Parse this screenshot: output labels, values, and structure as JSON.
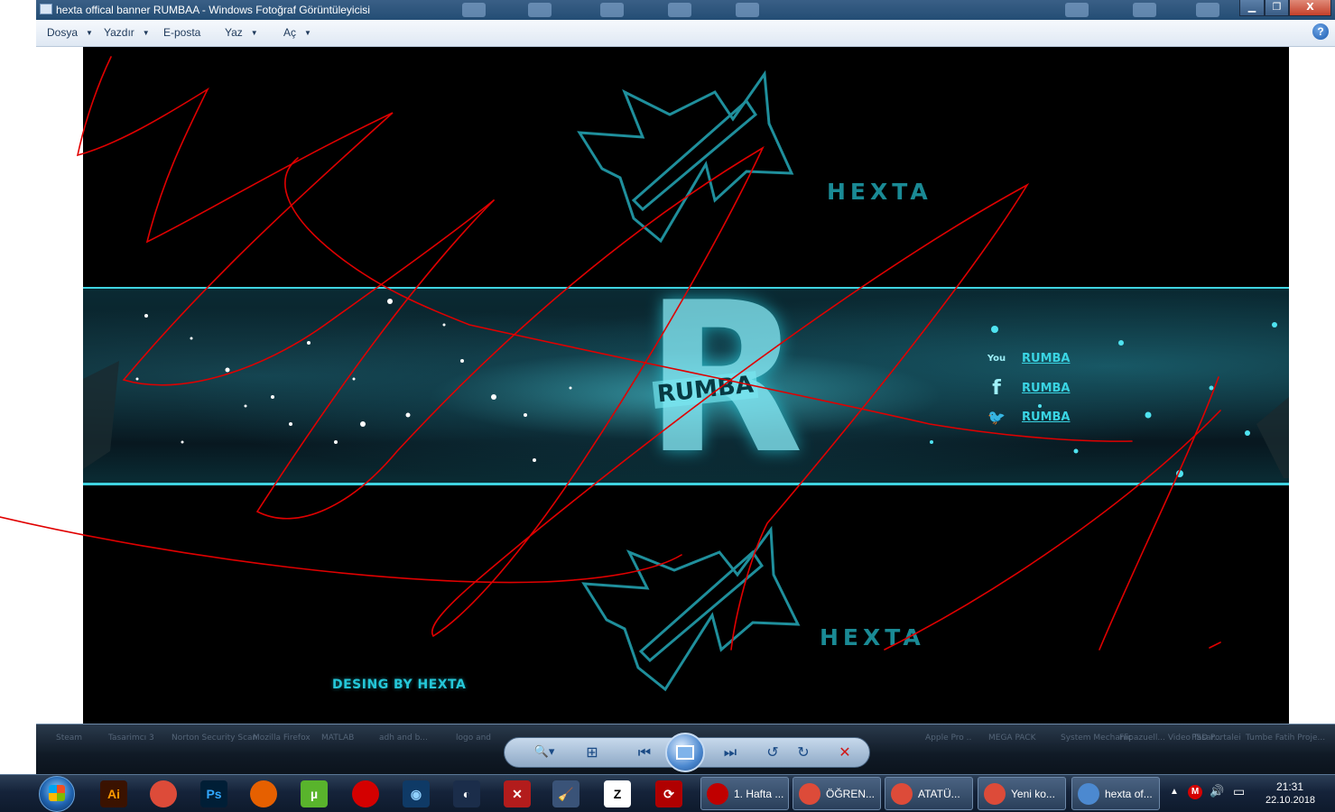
{
  "window": {
    "title": "hexta offical banner RUMBAA - Windows Fotoğraf Görüntüleyicisi",
    "minimize_glyph": "▁",
    "maximize_glyph": "❐",
    "close_glyph": "X"
  },
  "menu": {
    "items": [
      {
        "label": "Dosya",
        "has_dropdown": true
      },
      {
        "label": "Yazdır",
        "has_dropdown": true
      },
      {
        "label": "E-posta",
        "has_dropdown": false
      },
      {
        "label": "Yaz",
        "has_dropdown": true
      },
      {
        "label": "Aç",
        "has_dropdown": true
      }
    ],
    "dropdown_glyph": "▼",
    "help_glyph": "?"
  },
  "image": {
    "brand": "HEXTA",
    "brand_bottom": "HEXTA",
    "center_letter": "R",
    "center_word": "RUMBA",
    "credit": "DESING BY HEXTA",
    "social": [
      {
        "icon": "youtube-icon",
        "glyph": "You",
        "label": "RUMBA"
      },
      {
        "icon": "facebook-icon",
        "glyph": "f",
        "label": "RUMBA"
      },
      {
        "icon": "twitter-icon",
        "glyph": "🐦",
        "label": "RUMBA"
      }
    ],
    "accent_color": "#25c7d8",
    "annotation_color": "#e00000"
  },
  "controls": {
    "zoom_glyph": "🔍▾",
    "fit_glyph": "⊞",
    "prev_glyph": "⏮",
    "next_glyph": "⏭",
    "rotate_ccw_glyph": "↺",
    "rotate_cw_glyph": "↻",
    "delete_glyph": "✕",
    "blurred_labels": [
      "Steam",
      "Tasarimcı 3",
      "Norton Security Scan",
      "Mozilla Firefox",
      "MATLAB",
      "adh and b...",
      "logo and",
      "Apple Pro ..",
      "MEGA PACK",
      "System Mechanic",
      "Flipazuell... Video Tasar...",
      "PSD Portalei",
      "Tumbe Fatih Proje..."
    ]
  },
  "taskbar": {
    "pinned": [
      {
        "name": "illustrator-icon",
        "glyph": "Ai",
        "color": "#ff9a00",
        "bg": "#3a1200"
      },
      {
        "name": "chrome-icon",
        "glyph": "",
        "color": "#ffffff",
        "bg": "#dd4b39"
      },
      {
        "name": "photoshop-icon",
        "glyph": "Ps",
        "color": "#31a8ff",
        "bg": "#001e36"
      },
      {
        "name": "firefox-icon",
        "glyph": "",
        "color": "#ffffff",
        "bg": "#e66000"
      },
      {
        "name": "utorrent-icon",
        "glyph": "µ",
        "color": "#ffffff",
        "bg": "#59b42c"
      },
      {
        "name": "record-icon",
        "glyph": "",
        "color": "#ffffff",
        "bg": "#d40000"
      },
      {
        "name": "camera-app-icon",
        "glyph": "◉",
        "color": "#8fd0ff",
        "bg": "#0f3a66"
      },
      {
        "name": "cinema4d-icon",
        "glyph": "◐",
        "color": "#ffffff",
        "bg": "#1b2d4a"
      },
      {
        "name": "tools-icon",
        "glyph": "✕",
        "color": "#ffffff",
        "bg": "#b31c1c"
      },
      {
        "name": "cleaner-icon",
        "glyph": "🧹",
        "color": "#ffffff",
        "bg": "#3a5378"
      },
      {
        "name": "zbrush-icon",
        "glyph": "Z",
        "color": "#000000",
        "bg": "#ffffff"
      },
      {
        "name": "sync-icon",
        "glyph": "⟳",
        "color": "#ffffff",
        "bg": "#b00000"
      }
    ],
    "tasks": [
      {
        "name": "task-pdf",
        "label": "1. Hafta ...",
        "icon_color": "#c00000"
      },
      {
        "name": "task-chrome-1",
        "label": "ÖĞREN...",
        "icon_color": "#dd4b39"
      },
      {
        "name": "task-chrome-2",
        "label": "ATATÜ...",
        "icon_color": "#dd4b39"
      },
      {
        "name": "task-chrome-3",
        "label": "Yeni ko...",
        "icon_color": "#dd4b39"
      },
      {
        "name": "task-photo-viewer",
        "label": "hexta of...",
        "icon_color": "#4c89d0"
      }
    ],
    "tray": {
      "expand_glyph": "▲",
      "mega_glyph": "M",
      "volume_glyph": "🔊",
      "network_glyph": "▭",
      "time": "21:31",
      "date": "22.10.2018"
    }
  }
}
